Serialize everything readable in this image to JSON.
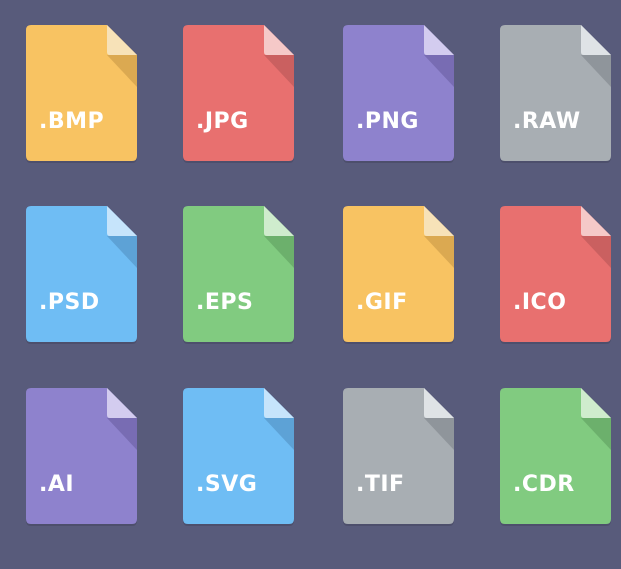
{
  "files": [
    {
      "label": ".BMP",
      "color": "#f8c362",
      "fold": "#f7e2b8",
      "shade": "#d6a54f"
    },
    {
      "label": ".JPG",
      "color": "#e8706f",
      "fold": "#f5c9c8",
      "shade": "#c45d5e"
    },
    {
      "label": ".PNG",
      "color": "#8e82cd",
      "fold": "#d3ccef",
      "shade": "#7468ae"
    },
    {
      "label": ".RAW",
      "color": "#a8aeb3",
      "fold": "#dfe3e6",
      "shade": "#8b9196"
    },
    {
      "label": ".PSD",
      "color": "#6fbdf4",
      "fold": "#c6e4fb",
      "shade": "#5a9dd0"
    },
    {
      "label": ".EPS",
      "color": "#81cb80",
      "fold": "#cfeccd",
      "shade": "#69ab69"
    },
    {
      "label": ".GIF",
      "color": "#f8c362",
      "fold": "#f7e2b8",
      "shade": "#d6a54f"
    },
    {
      "label": ".ICO",
      "color": "#e8706f",
      "fold": "#f5c9c8",
      "shade": "#c45d5e"
    },
    {
      "label": ".AI",
      "color": "#8e82cd",
      "fold": "#d3ccef",
      "shade": "#7468ae"
    },
    {
      "label": ".SVG",
      "color": "#6fbdf4",
      "fold": "#c6e4fb",
      "shade": "#5a9dd0"
    },
    {
      "label": ".TIF",
      "color": "#a8aeb3",
      "fold": "#dfe3e6",
      "shade": "#8b9196"
    },
    {
      "label": ".CDR",
      "color": "#81cb80",
      "fold": "#cfeccd",
      "shade": "#69ab69"
    }
  ]
}
